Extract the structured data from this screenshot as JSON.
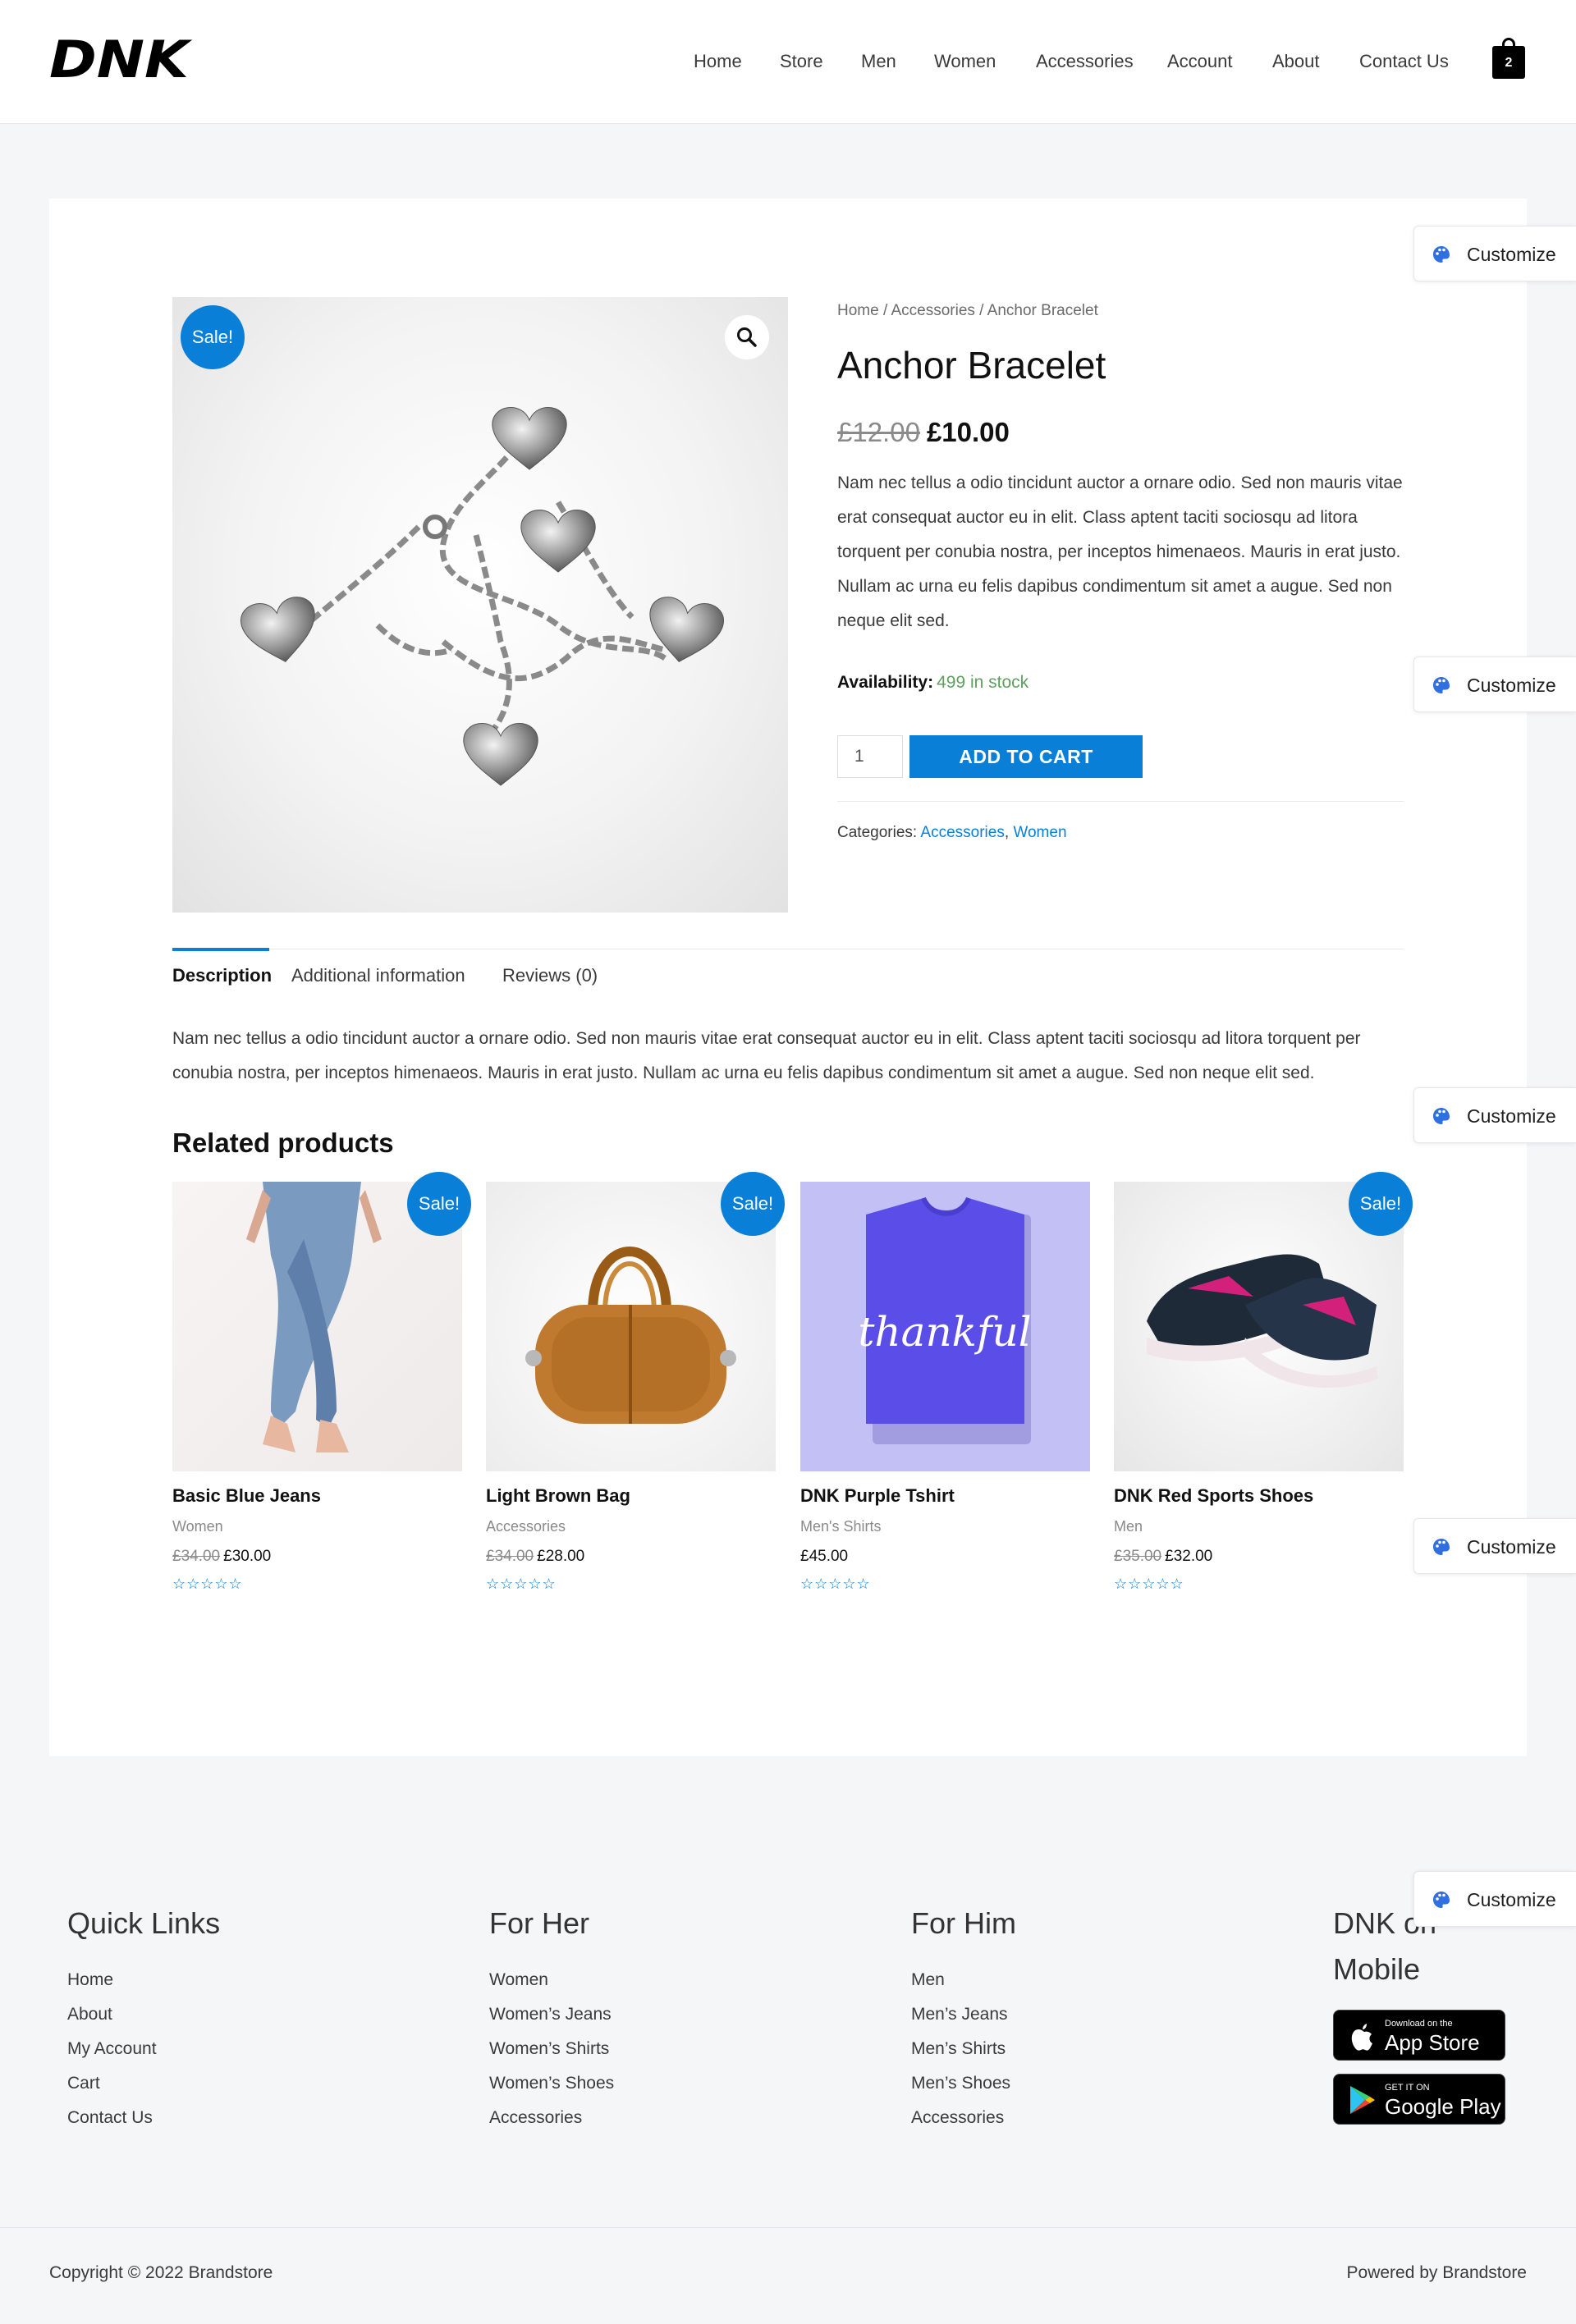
{
  "header": {
    "logo_text": "DNK",
    "nav": [
      "Home",
      "Store",
      "Men",
      "Women",
      "Accessories",
      "Account",
      "About",
      "Contact Us"
    ],
    "cart_count": "2"
  },
  "customize_label": "Customize",
  "product": {
    "breadcrumb": "Home / Accessories / Anchor Bracelet",
    "title": "Anchor Bracelet",
    "sale_badge": "Sale!",
    "old_price": "£12.00",
    "price": "£10.00",
    "short_description": "Nam nec tellus a odio tincidunt auctor a ornare odio. Sed non mauris vitae erat consequat auctor eu in elit. Class aptent taciti sociosqu ad litora torquent per conubia nostra, per inceptos himenaeos. Mauris in erat justo. Nullam ac urna eu felis dapibus condimentum sit amet a augue. Sed non neque elit sed.",
    "availability_label": "Availability:",
    "availability_value": "499 in stock",
    "quantity": "1",
    "add_to_cart": "ADD TO CART",
    "categories_label": "Categories:",
    "categories": [
      "Accessories",
      "Women"
    ]
  },
  "tabs": [
    "Description",
    "Additional information",
    "Reviews (0)"
  ],
  "description": "Nam nec tellus a odio tincidunt auctor a ornare odio. Sed non mauris vitae erat consequat auctor eu in elit. Class aptent taciti sociosqu ad litora torquent per conubia nostra, per inceptos himenaeos. Mauris in erat justo. Nullam ac urna eu felis dapibus condimentum sit amet a augue. Sed non neque elit sed.",
  "related": {
    "title": "Related products",
    "items": [
      {
        "name": "Basic Blue Jeans",
        "category": "Women",
        "old_price": "£34.00",
        "price": "£30.00",
        "sale": "Sale!",
        "stars": "☆☆☆☆☆"
      },
      {
        "name": "Light Brown Bag",
        "category": "Accessories",
        "old_price": "£34.00",
        "price": "£28.00",
        "sale": "Sale!",
        "stars": "☆☆☆☆☆"
      },
      {
        "name": "DNK Purple Tshirt",
        "category": "Men's Shirts",
        "old_price": "",
        "price": "£45.00",
        "sale": "",
        "stars": "☆☆☆☆☆",
        "shirt_text": "thankful"
      },
      {
        "name": "DNK Red Sports Shoes",
        "category": "Men",
        "old_price": "£35.00",
        "price": "£32.00",
        "sale": "Sale!",
        "stars": "☆☆☆☆☆"
      }
    ]
  },
  "footer": {
    "quick_links": {
      "title": "Quick Links",
      "items": [
        "Home",
        "About",
        "My Account",
        "Cart",
        "Contact Us"
      ]
    },
    "for_her": {
      "title": "For Her",
      "items": [
        "Women",
        "Women’s Jeans",
        "Women’s Shirts",
        "Women’s Shoes",
        "Accessories"
      ]
    },
    "for_him": {
      "title": "For Him",
      "items": [
        "Men",
        "Men’s Jeans",
        "Men’s Shirts",
        "Men’s Shoes",
        "Accessories"
      ]
    },
    "mobile": {
      "title_line1": "DNK on",
      "title_line2": "Mobile",
      "app_store_small": "Download on the",
      "app_store_big": "App Store",
      "google_small": "GET IT ON",
      "google_big": "Google Play"
    },
    "copyright": "Copyright © 2022 Brandstore",
    "powered": "Powered by Brandstore"
  },
  "colors": {
    "accent": "#0a7fd8",
    "in_stock": "#5fa05f",
    "tshirt_bg": "#c3c0f5",
    "tshirt": "#5a4de8"
  }
}
